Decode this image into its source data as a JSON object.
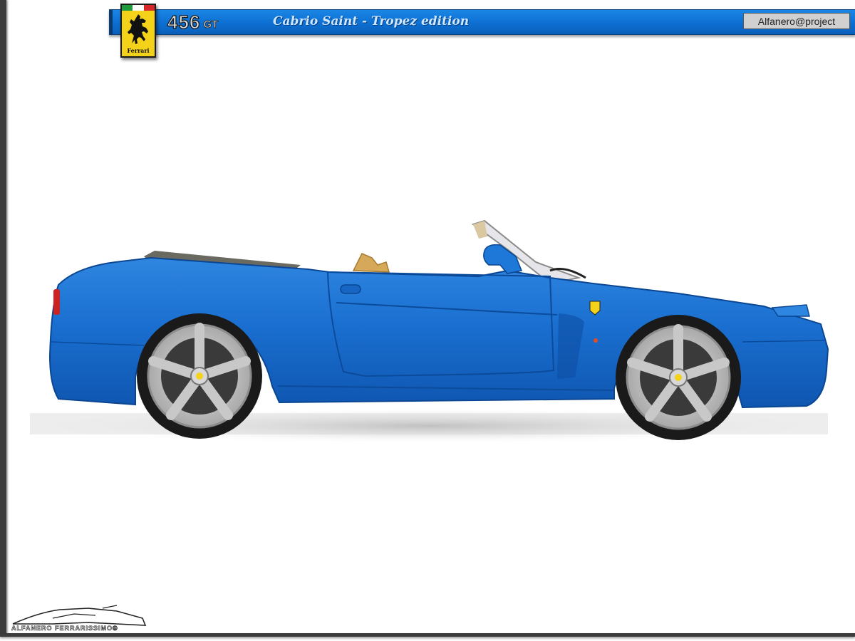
{
  "header": {
    "model_number": "456",
    "model_suffix": "GT",
    "edition": "Cabrio Saint - Tropez edition",
    "project_label": "Alfanero@project",
    "banner_color": "#0d6fd2"
  },
  "logo": {
    "icon": "prancing-horse-icon",
    "brand_text": "Ferrari",
    "shield_color": "#f5d21a",
    "flag_colors": [
      "#1e9b3a",
      "#ffffff",
      "#d62828"
    ]
  },
  "photo": {
    "subject": "blue-convertible-car",
    "body_color": "#1a6fd0",
    "wheel_color": "#c8c8c8",
    "seat_color": "#d6a95a"
  },
  "signature": {
    "text": "ALFANERO FERRARISSIMO©"
  }
}
